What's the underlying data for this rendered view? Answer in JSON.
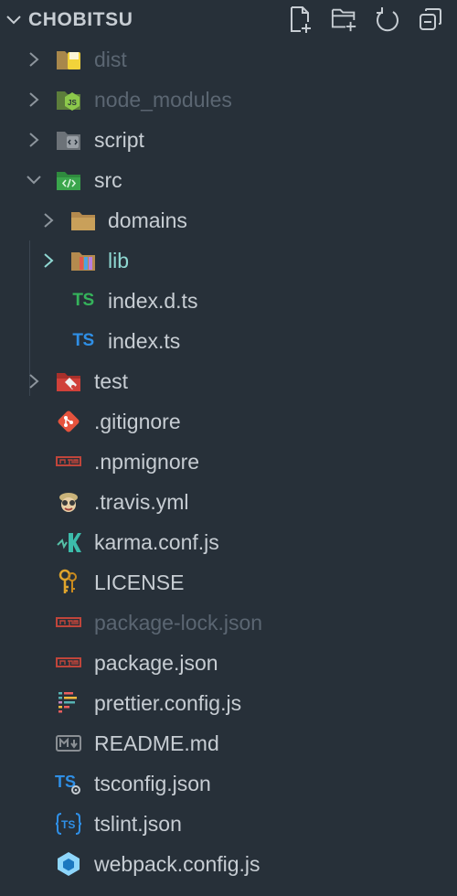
{
  "explorer": {
    "title": "CHOBITSU",
    "actions": [
      "new-file-icon",
      "new-folder-icon",
      "refresh-icon",
      "collapse-all-icon"
    ]
  },
  "tree": {
    "items": [
      {
        "label": "dist",
        "type": "folder",
        "expanded": false,
        "depth": 0,
        "icon": "folder-dist-icon",
        "dimmed": true
      },
      {
        "label": "node_modules",
        "type": "folder",
        "expanded": false,
        "depth": 0,
        "icon": "folder-node-icon",
        "dimmed": true
      },
      {
        "label": "script",
        "type": "folder",
        "expanded": false,
        "depth": 0,
        "icon": "folder-script-icon"
      },
      {
        "label": "src",
        "type": "folder",
        "expanded": true,
        "depth": 0,
        "icon": "folder-src-icon"
      },
      {
        "label": "domains",
        "type": "folder",
        "expanded": false,
        "depth": 1,
        "icon": "folder-icon"
      },
      {
        "label": "lib",
        "type": "folder",
        "expanded": false,
        "depth": 1,
        "icon": "folder-lib-icon",
        "highlight": true
      },
      {
        "label": "index.d.ts",
        "type": "file",
        "depth": 1,
        "icon": "typescript-def-icon"
      },
      {
        "label": "index.ts",
        "type": "file",
        "depth": 1,
        "icon": "typescript-icon"
      },
      {
        "label": "test",
        "type": "folder",
        "expanded": false,
        "depth": 0,
        "icon": "folder-test-icon"
      },
      {
        "label": ".gitignore",
        "type": "file",
        "depth": 0,
        "icon": "git-icon"
      },
      {
        "label": ".npmignore",
        "type": "file",
        "depth": 0,
        "icon": "npm-icon"
      },
      {
        "label": ".travis.yml",
        "type": "file",
        "depth": 0,
        "icon": "travis-icon"
      },
      {
        "label": "karma.conf.js",
        "type": "file",
        "depth": 0,
        "icon": "karma-icon"
      },
      {
        "label": "LICENSE",
        "type": "file",
        "depth": 0,
        "icon": "license-key-icon"
      },
      {
        "label": "package-lock.json",
        "type": "file",
        "depth": 0,
        "icon": "npm-icon",
        "dimmed": true
      },
      {
        "label": "package.json",
        "type": "file",
        "depth": 0,
        "icon": "npm-icon"
      },
      {
        "label": "prettier.config.js",
        "type": "file",
        "depth": 0,
        "icon": "prettier-icon"
      },
      {
        "label": "README.md",
        "type": "file",
        "depth": 0,
        "icon": "markdown-icon"
      },
      {
        "label": "tsconfig.json",
        "type": "file",
        "depth": 0,
        "icon": "tsconfig-icon"
      },
      {
        "label": "tslint.json",
        "type": "file",
        "depth": 0,
        "icon": "tslint-icon"
      },
      {
        "label": "webpack.config.js",
        "type": "file",
        "depth": 0,
        "icon": "webpack-icon"
      }
    ]
  },
  "colors": {
    "background": "#273039",
    "text": "#c7cdd3",
    "dimmed": "#5b6672",
    "highlight": "#8fd8d2",
    "folder": "#c9a05a"
  }
}
